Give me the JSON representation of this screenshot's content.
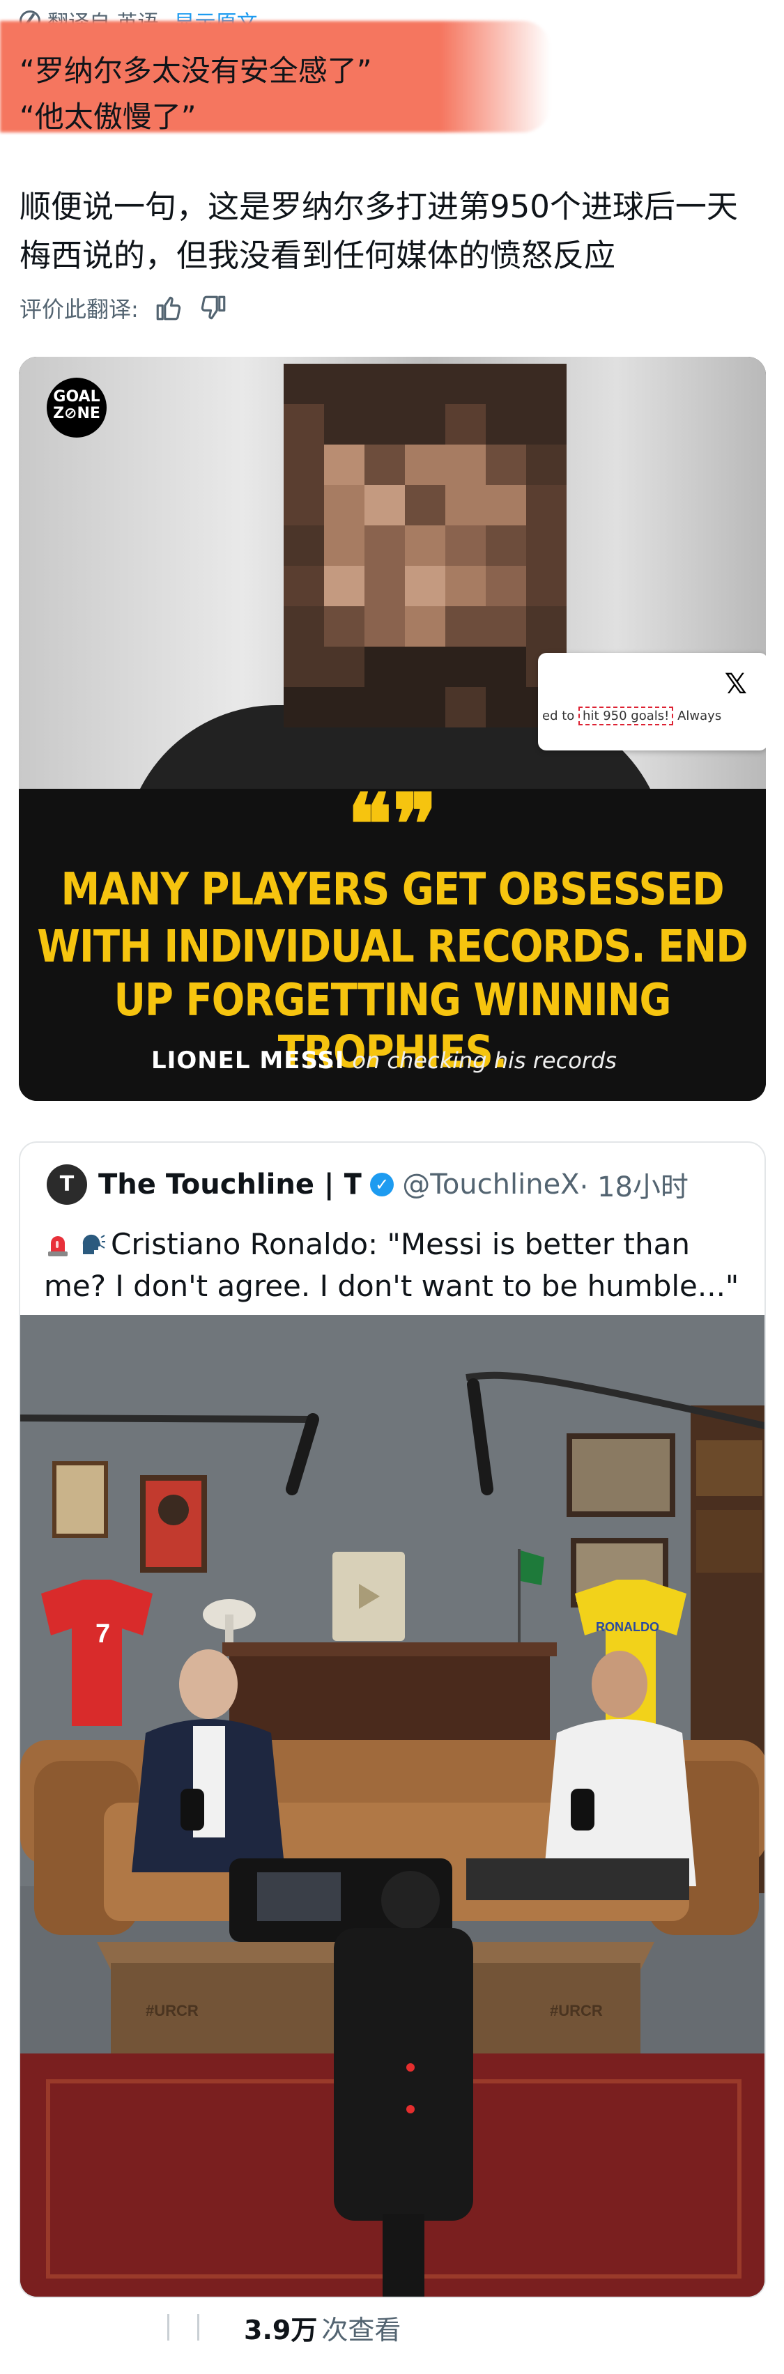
{
  "translation_bar": {
    "label": "翻译自 英语",
    "show_original": "显示原文"
  },
  "quote": {
    "line1": "“罗纳尔多太没有安全感了”",
    "line2": "“他太傲慢了”"
  },
  "body_text": "顺便说一句，这是罗纳尔多打进第950个进球后一天梅西说的，但我没看到任何媒体的愤怒反应",
  "rate": {
    "label": "评价此翻译:"
  },
  "card1": {
    "logo": "GOAL ZONE",
    "x_card_text": "ed to",
    "x_card_box": "hit 950 goals!",
    "x_card_suffix": "Always",
    "quote_lines": [
      "MANY PLAYERS GET OBSESSED",
      "WITH INDIVIDUAL RECORDS. END",
      "UP FORGETTING WINNING TROPHIES."
    ],
    "attrib_name": "LIONEL MESSI",
    "attrib_rest": "on checking his records"
  },
  "tweet": {
    "avatar": "T",
    "name": "The Touchline | 𝐓",
    "handle": "@TouchlineX",
    "time": "· 18小时",
    "text": "Cristiano Ronaldo: \"Messi is better than me? I don't agree. I don't want to be humble...\"",
    "photo": {
      "jersey_left": "7",
      "jersey_right": "RONALDO",
      "table_left": "#URCR",
      "table_right": "#URCR"
    }
  },
  "footer": {
    "views": "3.9万",
    "views_suffix": "次查看"
  },
  "colors": {
    "link": "#1d9bf0",
    "highlight": "#f5765f",
    "quote_yellow": "#f6c40f"
  }
}
